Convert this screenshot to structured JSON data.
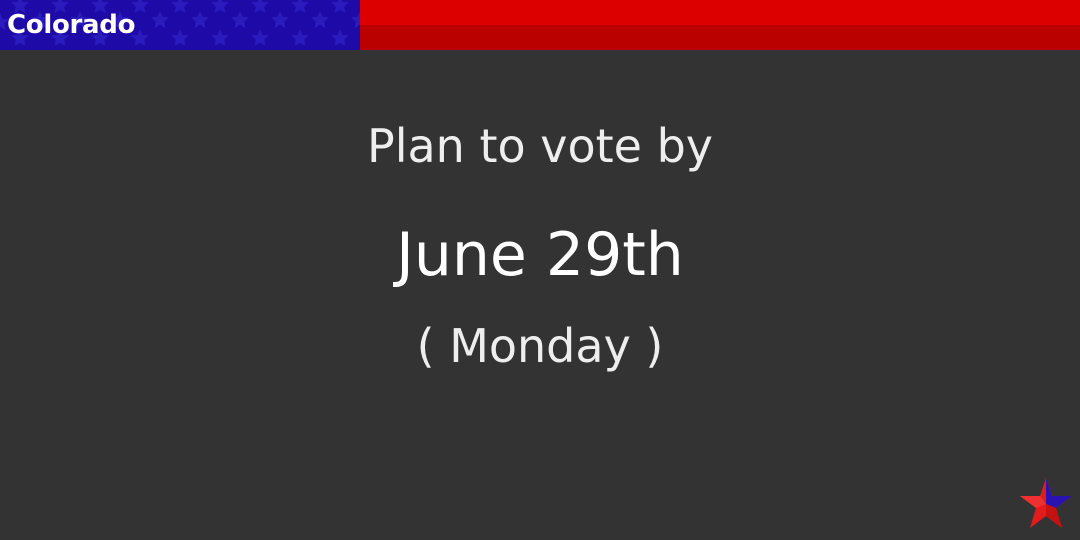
{
  "banner": {
    "state": "Colorado",
    "colors": {
      "blue": "#1e0aa6",
      "star_pattern": "#2b1bbd",
      "red_top": "#dd0000",
      "red_bottom": "#bb0000"
    }
  },
  "message": {
    "intro": "Plan to vote by",
    "date": "June 29th",
    "weekday": "( Monday )"
  },
  "logo": {
    "icon": "star-logo-icon",
    "colors": {
      "red": "#e21c1c",
      "blue": "#2a13b0"
    }
  },
  "theme": {
    "background": "#333333",
    "text": "#eeeeee"
  }
}
